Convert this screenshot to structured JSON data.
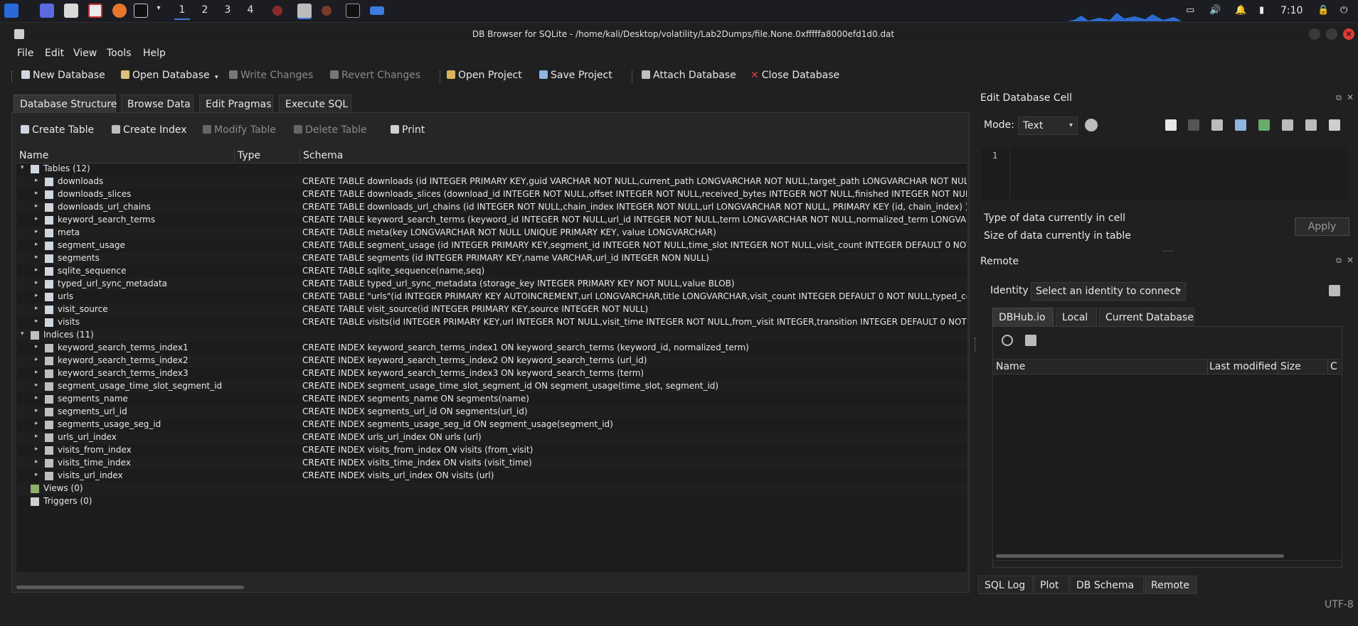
{
  "taskbar": {
    "workspaces": [
      "1",
      "2",
      "3",
      "4"
    ],
    "time": "7:10"
  },
  "window": {
    "title": "DB Browser for SQLite - /home/kali/Desktop/volatility/Lab2Dumps/file.None.0xfffffa8000efd1d0.dat"
  },
  "menu": [
    "File",
    "Edit",
    "View",
    "Tools",
    "Help"
  ],
  "toolbar": {
    "new_database": "New Database",
    "open_database": "Open Database",
    "write_changes": "Write Changes",
    "revert_changes": "Revert Changes",
    "open_project": "Open Project",
    "save_project": "Save Project",
    "attach_database": "Attach Database",
    "close_database": "Close Database"
  },
  "tabs": [
    "Database Structure",
    "Browse Data",
    "Edit Pragmas",
    "Execute SQL"
  ],
  "structure_toolbar": {
    "create_table": "Create Table",
    "create_index": "Create Index",
    "modify_table": "Modify Table",
    "delete_table": "Delete Table",
    "print": "Print"
  },
  "tree": {
    "columns": [
      "Name",
      "Type",
      "Schema"
    ],
    "tables_label": "Tables (12)",
    "tables": [
      {
        "name": "downloads",
        "schema": "CREATE TABLE downloads (id INTEGER PRIMARY KEY,guid VARCHAR NOT NULL,current_path LONGVARCHAR NOT NULL,target_path LONGVARCHAR NOT NULL"
      },
      {
        "name": "downloads_slices",
        "schema": "CREATE TABLE downloads_slices (download_id INTEGER NOT NULL,offset INTEGER NOT NULL,received_bytes INTEGER NOT NULL,finished INTEGER NOT NULL I"
      },
      {
        "name": "downloads_url_chains",
        "schema": "CREATE TABLE downloads_url_chains (id INTEGER NOT NULL,chain_index INTEGER NOT NULL,url LONGVARCHAR NOT NULL, PRIMARY KEY (id, chain_index) )"
      },
      {
        "name": "keyword_search_terms",
        "schema": "CREATE TABLE keyword_search_terms (keyword_id INTEGER NOT NULL,url_id INTEGER NOT NULL,term LONGVARCHAR NOT NULL,normalized_term LONGVARC"
      },
      {
        "name": "meta",
        "schema": "CREATE TABLE meta(key LONGVARCHAR NOT NULL UNIQUE PRIMARY KEY, value LONGVARCHAR)"
      },
      {
        "name": "segment_usage",
        "schema": "CREATE TABLE segment_usage (id INTEGER PRIMARY KEY,segment_id INTEGER NOT NULL,time_slot INTEGER NOT NULL,visit_count INTEGER DEFAULT 0 NOT N"
      },
      {
        "name": "segments",
        "schema": "CREATE TABLE segments (id INTEGER PRIMARY KEY,name VARCHAR,url_id INTEGER NON NULL)"
      },
      {
        "name": "sqlite_sequence",
        "schema": "CREATE TABLE sqlite_sequence(name,seq)"
      },
      {
        "name": "typed_url_sync_metadata",
        "schema": "CREATE TABLE typed_url_sync_metadata (storage_key INTEGER PRIMARY KEY NOT NULL,value BLOB)"
      },
      {
        "name": "urls",
        "schema": "CREATE TABLE \"urls\"(id INTEGER PRIMARY KEY AUTOINCREMENT,url LONGVARCHAR,title LONGVARCHAR,visit_count INTEGER DEFAULT 0 NOT NULL,typed_co"
      },
      {
        "name": "visit_source",
        "schema": "CREATE TABLE visit_source(id INTEGER PRIMARY KEY,source INTEGER NOT NULL)"
      },
      {
        "name": "visits",
        "schema": "CREATE TABLE visits(id INTEGER PRIMARY KEY,url INTEGER NOT NULL,visit_time INTEGER NOT NULL,from_visit INTEGER,transition INTEGER DEFAULT 0 NOT N"
      }
    ],
    "indices_label": "Indices (11)",
    "indices": [
      {
        "name": "keyword_search_terms_index1",
        "schema": "CREATE INDEX keyword_search_terms_index1 ON keyword_search_terms (keyword_id, normalized_term)"
      },
      {
        "name": "keyword_search_terms_index2",
        "schema": "CREATE INDEX keyword_search_terms_index2 ON keyword_search_terms (url_id)"
      },
      {
        "name": "keyword_search_terms_index3",
        "schema": "CREATE INDEX keyword_search_terms_index3 ON keyword_search_terms (term)"
      },
      {
        "name": "segment_usage_time_slot_segment_id",
        "schema": "CREATE INDEX segment_usage_time_slot_segment_id ON segment_usage(time_slot, segment_id)"
      },
      {
        "name": "segments_name",
        "schema": "CREATE INDEX segments_name ON segments(name)"
      },
      {
        "name": "segments_url_id",
        "schema": "CREATE INDEX segments_url_id ON segments(url_id)"
      },
      {
        "name": "segments_usage_seg_id",
        "schema": "CREATE INDEX segments_usage_seg_id ON segment_usage(segment_id)"
      },
      {
        "name": "urls_url_index",
        "schema": "CREATE INDEX urls_url_index ON urls (url)"
      },
      {
        "name": "visits_from_index",
        "schema": "CREATE INDEX visits_from_index ON visits (from_visit)"
      },
      {
        "name": "visits_time_index",
        "schema": "CREATE INDEX visits_time_index ON visits (visit_time)"
      },
      {
        "name": "visits_url_index",
        "schema": "CREATE INDEX visits_url_index ON visits (url)"
      }
    ],
    "views_label": "Views (0)",
    "triggers_label": "Triggers (0)"
  },
  "edit_cell": {
    "title": "Edit Database Cell",
    "mode_label": "Mode:",
    "mode_value": "Text",
    "line_number": "1",
    "type_label": "Type of data currently in cell",
    "size_label": "Size of data currently in table",
    "apply": "Apply"
  },
  "remote": {
    "title": "Remote",
    "identity_label": "Identity",
    "identity_value": "Select an identity to connect",
    "tabs": [
      "DBHub.io",
      "Local",
      "Current Database"
    ],
    "columns": [
      "Name",
      "Last modified",
      "Size",
      "C"
    ]
  },
  "bottom_tabs": [
    "SQL Log",
    "Plot",
    "DB Schema",
    "Remote"
  ],
  "status": {
    "encoding": "UTF-8"
  },
  "colors": {
    "accent": "#3d7be0",
    "close_red": "#e03b3b"
  }
}
